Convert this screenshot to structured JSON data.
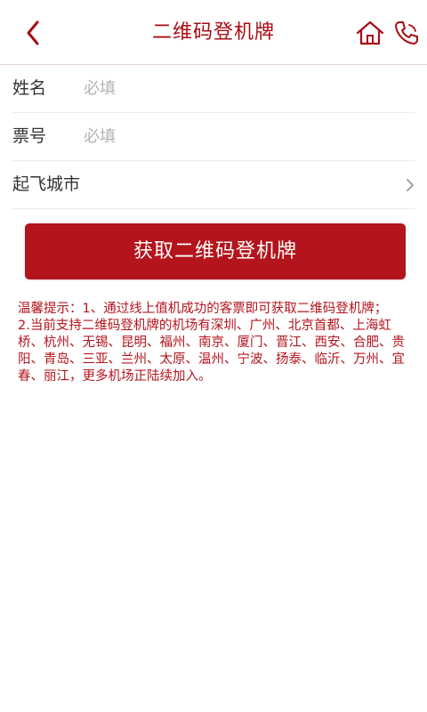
{
  "header": {
    "title": "二维码登机牌"
  },
  "form": {
    "rows": [
      {
        "label": "姓名",
        "placeholder": "必填",
        "value": ""
      },
      {
        "label": "票号",
        "placeholder": "必填",
        "value": ""
      },
      {
        "label": "起飞城市"
      }
    ]
  },
  "submit": {
    "label": "获取二维码登机牌"
  },
  "tips": {
    "line1": "温馨提示：1、通过线上值机成功的客票即可获取二维码登机牌；",
    "line2": "2.当前支持二维码登机牌的机场有深圳、广州、北京首都、上海虹桥、杭州、无锡、昆明、福州、南京、厦门、晋江、西安、合肥、贵阳、青岛、三亚、兰州、太原、温州、宁波、扬泰、临沂、万州、宜春、丽江，更多机场正陆续加入。"
  },
  "colors": {
    "brand_red": "#b4141c",
    "title_red": "#a80c14",
    "placeholder_gray": "#b3b3b3"
  },
  "icons": [
    "back-arrow-icon",
    "home-icon",
    "phone-icon",
    "chevron-right-icon"
  ]
}
